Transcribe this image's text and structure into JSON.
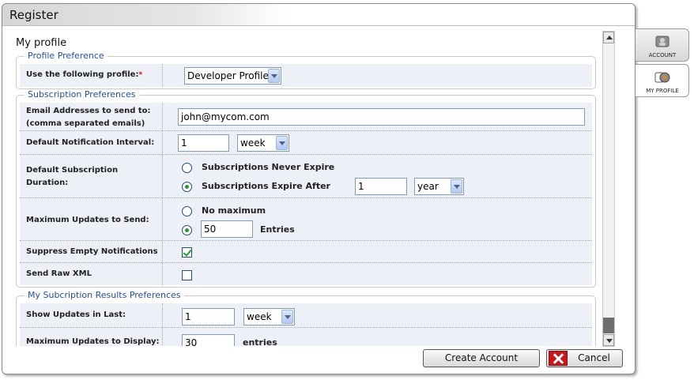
{
  "dialog": {
    "title": "Register"
  },
  "page": {
    "title": "My profile"
  },
  "profile_preference": {
    "legend": "Profile Preference",
    "use_profile_label": "Use the following profile:",
    "required_mark": "*",
    "profile_value": "Developer Profile"
  },
  "subscription": {
    "legend": "Subscription Preferences",
    "email_label_1": "Email Addresses to send to:",
    "email_label_2": "(comma separated emails)",
    "email_value": "john@mycom.com",
    "interval_label": "Default Notification Interval:",
    "interval_value": "1",
    "interval_unit": "week",
    "duration_label_1": "Default Subscription",
    "duration_label_2": "Duration:",
    "never_expire": "Subscriptions Never Expire",
    "expire_after": "Subscriptions Expire After",
    "expire_value": "1",
    "expire_unit": "year",
    "max_updates_label": "Maximum Updates to Send:",
    "no_max": "No maximum",
    "max_value": "50",
    "entries": "Entries",
    "suppress_label": "Suppress Empty Notifications",
    "suppress_checked": true,
    "raw_xml_label": "Send Raw XML",
    "raw_xml_checked": false
  },
  "results": {
    "legend": "My Subcription Results Preferences",
    "show_updates_label": "Show Updates in Last:",
    "show_updates_value": "1",
    "show_updates_unit": "week",
    "max_display_label": "Maximum Updates to Display:",
    "max_display_value": "30",
    "entries": "entries"
  },
  "buttons": {
    "create": "Create Account",
    "cancel": "Cancel"
  },
  "side_tabs": [
    {
      "label": "ACCOUNT",
      "icon": "account-icon"
    },
    {
      "label": "MY PROFILE",
      "icon": "profile-icon"
    }
  ]
}
